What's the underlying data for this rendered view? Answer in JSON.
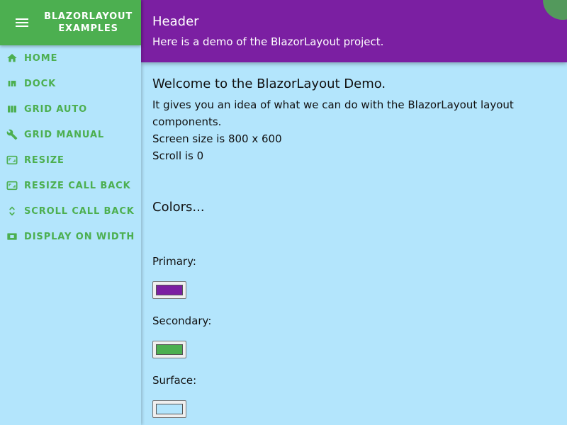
{
  "sidebar": {
    "title_line1": "BLAZORLAYOUT",
    "title_line2": "EXAMPLES",
    "items": [
      {
        "label": "HOME",
        "icon": "home-icon"
      },
      {
        "label": "DOCK",
        "icon": "dock-icon"
      },
      {
        "label": "GRID AUTO",
        "icon": "grid-columns-icon"
      },
      {
        "label": "GRID MANUAL",
        "icon": "wrench-icon"
      },
      {
        "label": "RESIZE",
        "icon": "aspect-ratio-icon"
      },
      {
        "label": "RESIZE CALL BACK",
        "icon": "aspect-ratio-icon"
      },
      {
        "label": "SCROLL CALL BACK",
        "icon": "unfold-icon"
      },
      {
        "label": "DISPLAY ON WIDTH",
        "icon": "display-icon"
      }
    ]
  },
  "header": {
    "title": "Header",
    "subtitle": "Here is a demo of the BlazorLayout project."
  },
  "main": {
    "welcome": "Welcome to the BlazorLayout Demo.",
    "description": "It gives you an idea of what we can do with the BlazorLayout layout components.",
    "screen_size": "Screen size is 800 x 600",
    "scroll": "Scroll is 0",
    "colors_heading": "Colors...",
    "colors": [
      {
        "label": "Primary:",
        "value": "#7b1fa2"
      },
      {
        "label": "Secondary:",
        "value": "#4caf50"
      },
      {
        "label": "Surface:",
        "value": "#b3e5fc"
      }
    ]
  },
  "theme": {
    "primary": "#7b1fa2",
    "secondary": "#4caf50",
    "surface": "#b3e5fc"
  }
}
